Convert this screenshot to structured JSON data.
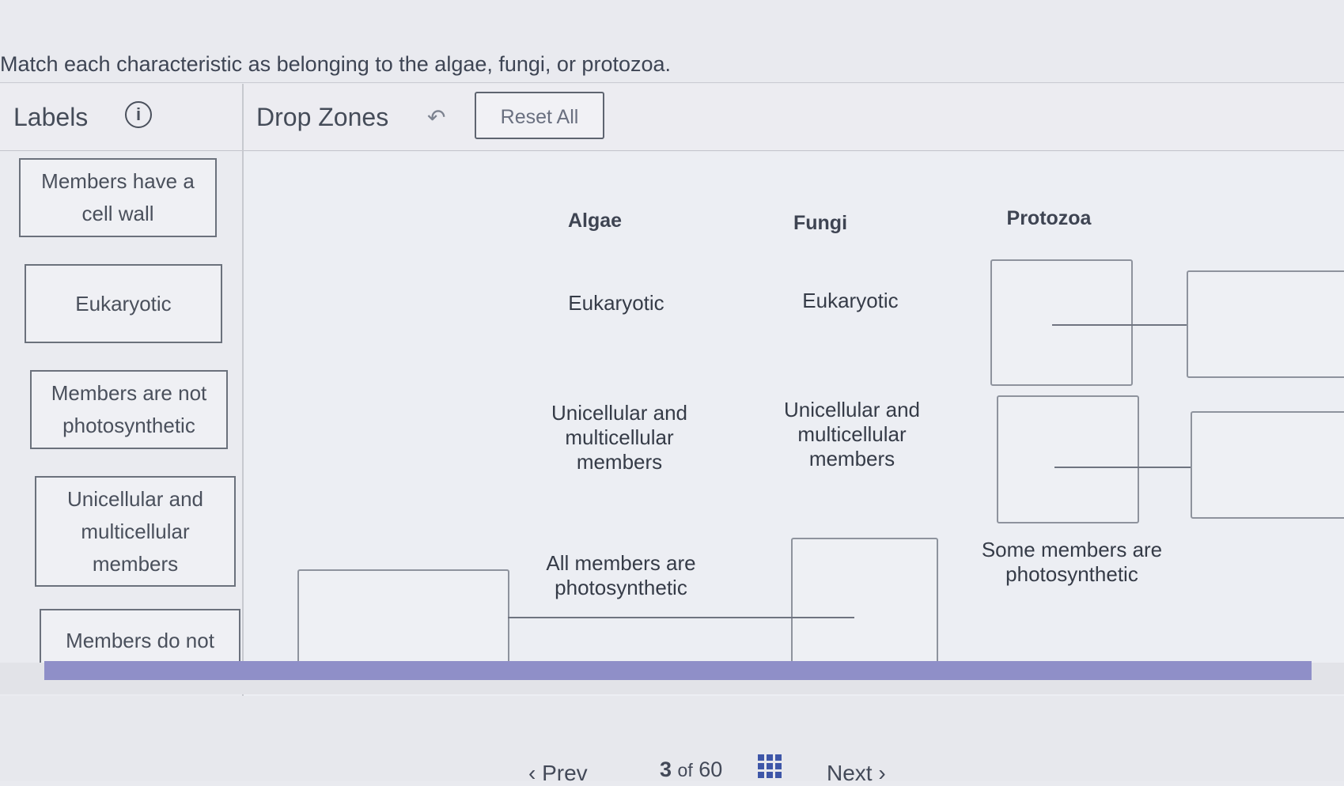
{
  "question": "Match each characteristic as belonging to the algae, fungi, or protozoa.",
  "labels_panel": {
    "title": "Labels",
    "info_icon": "i",
    "items": [
      "Members have a cell wall",
      "Eukaryotic",
      "Members are not photosynthetic",
      "Unicellular and multicellular members",
      "Members do not"
    ]
  },
  "drop_zones": {
    "title": "Drop Zones",
    "undo_icon": "↶",
    "reset_label": "Reset All",
    "columns": [
      "Algae",
      "Fungi",
      "Protozoa"
    ],
    "algae": [
      "Eukaryotic",
      "Unicellular and multicellular members",
      "All members are photosynthetic"
    ],
    "fungi": [
      "Eukaryotic",
      "Unicellular and multicellular members"
    ],
    "protozoa": [
      "Some members are photosynthetic"
    ]
  },
  "footer": {
    "prev_label": "Prev",
    "current_page": "3",
    "of_label": "of",
    "total_pages": "60",
    "next_label": "Next",
    "prev_icon": "‹",
    "next_icon": "›"
  }
}
